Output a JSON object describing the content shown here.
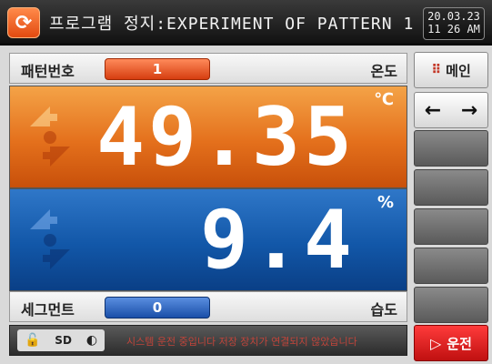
{
  "title_bar": {
    "title": "프로그램 정지:EXPERIMENT OF PATTERN 1",
    "date": "20.03.23",
    "time": "11 26 AM"
  },
  "pattern_row": {
    "label": "패턴번호",
    "value": "1",
    "right_label": "온도"
  },
  "temperature": {
    "value": "49.35",
    "unit": "℃"
  },
  "humidity": {
    "value": "9.4",
    "unit": "%"
  },
  "segment_row": {
    "label": "세그먼트",
    "value": "0",
    "right_label": "습도"
  },
  "status_bar": {
    "icons": [
      "lock-icon",
      "sd-card-icon",
      "mouse-icon"
    ],
    "message": "시스템 운전 중입니다 저장 장치가 연결되지 않았습니다"
  },
  "side_menu": {
    "menu_label": "메인",
    "run_label": "운전"
  },
  "colors": {
    "temperature_panel": "#e4701c",
    "humidity_panel": "#1257a8",
    "run_button": "#e02020",
    "menu_dots": "#c43a2a"
  }
}
